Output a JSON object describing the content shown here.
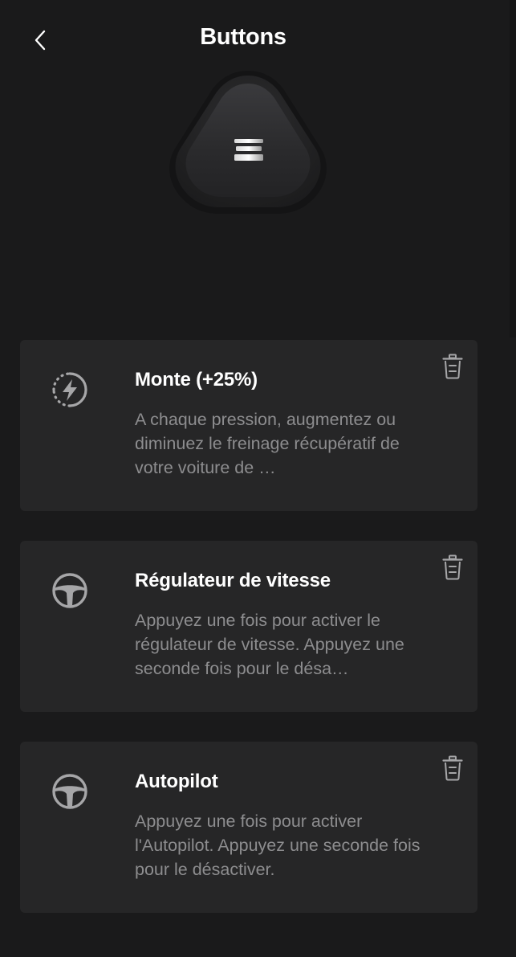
{
  "header": {
    "title": "Buttons",
    "back_icon": "chevron-left-icon"
  },
  "device": {
    "icon": "tesla-logo-icon"
  },
  "cards": [
    {
      "icon": "regen-braking-icon",
      "title": "Monte (+25%)",
      "description": "A chaque pression, augmentez ou diminuez le freinage récupératif de votre voiture de …",
      "delete_icon": "trash-icon"
    },
    {
      "icon": "steering-wheel-icon",
      "title": "Régulateur de vitesse",
      "description": "Appuyez une fois pour activer le régulateur de vitesse. Appuyez une seconde fois pour le désa…",
      "delete_icon": "trash-icon"
    },
    {
      "icon": "steering-wheel-icon",
      "title": "Autopilot",
      "description": "Appuyez une fois pour activer l'Autopilot. Appuyez une seconde fois pour le désactiver.",
      "delete_icon": "trash-icon"
    }
  ],
  "colors": {
    "background": "#1a1a1b",
    "card": "#262627",
    "title_text": "#ffffff",
    "description_text": "#8d8d8f",
    "icon": "#a6a6a8"
  }
}
